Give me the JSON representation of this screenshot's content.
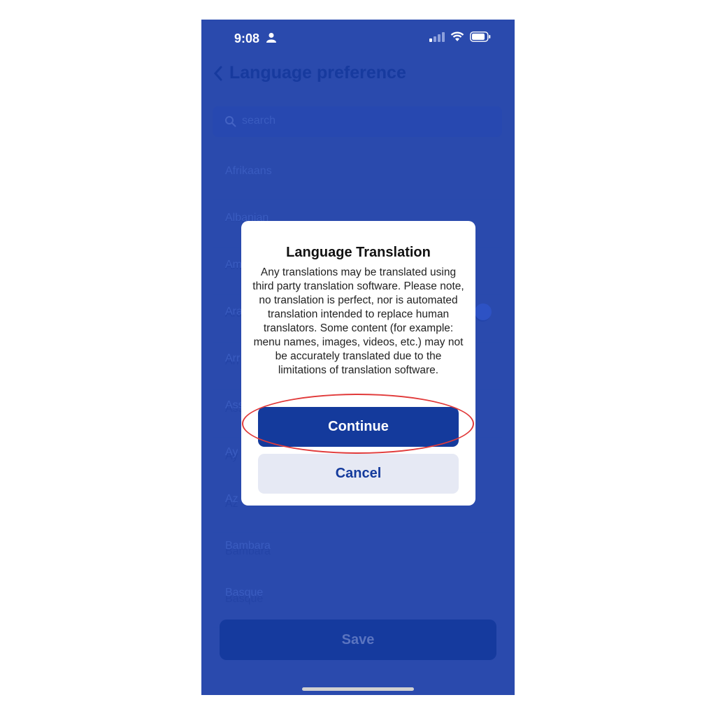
{
  "status_bar": {
    "time": "9:08"
  },
  "nav": {
    "title": "Language preference"
  },
  "search": {
    "placeholder": "search"
  },
  "languages": [
    {
      "label": "Afrikaans"
    },
    {
      "label": "Albanian"
    },
    {
      "label": "Am"
    },
    {
      "label": "Ara"
    },
    {
      "label": "Arr"
    },
    {
      "label": "Ass"
    },
    {
      "label": "Ay"
    },
    {
      "label": "Az"
    },
    {
      "label": "Bambara"
    },
    {
      "label": "Basque"
    }
  ],
  "save_label": "Save",
  "dialog": {
    "title": "Language Translation",
    "body": "Any translations may be translated using third party translation software. Please note, no translation is perfect, nor is automated translation intended to replace human translators. Some content (for example: menu names, images, videos, etc.) may not be accurately translated due to the limitations of translation software.",
    "continue_label": "Continue",
    "cancel_label": "Cancel"
  },
  "colors": {
    "overlay": "#2344aa",
    "primary": "#143a9c",
    "cancel_bg": "#e6e9f4",
    "highlight": "#e13a3a"
  }
}
